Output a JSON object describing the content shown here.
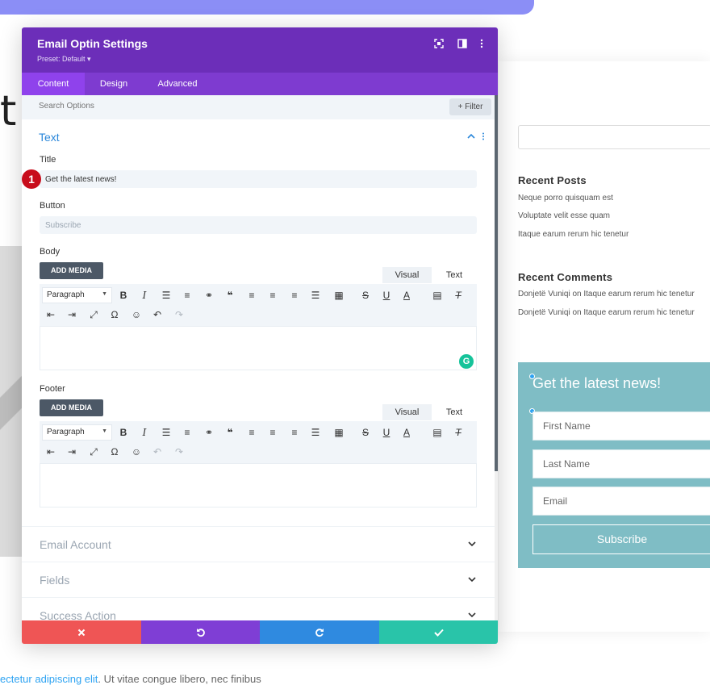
{
  "background": {
    "heading_fragment": "t",
    "body_text": {
      "link": "ectetur adipiscing elit",
      "rest": ". Ut vitae congue libero, nec finibus"
    },
    "sidebar": {
      "recent_posts_heading": "Recent Posts",
      "recent_posts": [
        "Neque porro quisquam est",
        "Voluptate velit esse quam",
        "Itaque earum rerum hic tenetur"
      ],
      "recent_comments_heading": "Recent Comments",
      "recent_comments": [
        "Donjetë Vuniqi on Itaque earum rerum hic tenetur",
        "Donjetë Vuniqi on Itaque earum rerum hic tenetur"
      ]
    },
    "optin_preview": {
      "title": "Get the latest news!",
      "fields": [
        "First Name",
        "Last Name",
        "Email"
      ],
      "button": "Subscribe"
    }
  },
  "modal": {
    "title": "Email Optin Settings",
    "preset": "Preset: Default ▾",
    "header_icons": [
      "focus-icon",
      "split-view-icon",
      "more-vertical-icon"
    ],
    "tabs": [
      {
        "label": "Content",
        "active": true
      },
      {
        "label": "Design",
        "active": false
      },
      {
        "label": "Advanced",
        "active": false
      }
    ],
    "search": {
      "placeholder": "Search Options",
      "filter_label": "+ Filter"
    },
    "section": {
      "title": "Text",
      "title_label": "Title",
      "title_value": "Get the latest news!",
      "button_label": "Button",
      "button_placeholder": "Subscribe",
      "body_label": "Body",
      "footer_label": "Footer",
      "add_media": "ADD MEDIA",
      "editor_tabs": [
        "Visual",
        "Text"
      ],
      "paragraph_select": "Paragraph"
    },
    "badge_number": "1",
    "collapsed_sections": [
      "Email Account",
      "Fields",
      "Success Action"
    ],
    "footer": {
      "colors": {
        "cancel": "#ef5555",
        "undo": "#7f3ed5",
        "redo": "#2f8ae0",
        "save": "#29c4a9"
      }
    }
  }
}
